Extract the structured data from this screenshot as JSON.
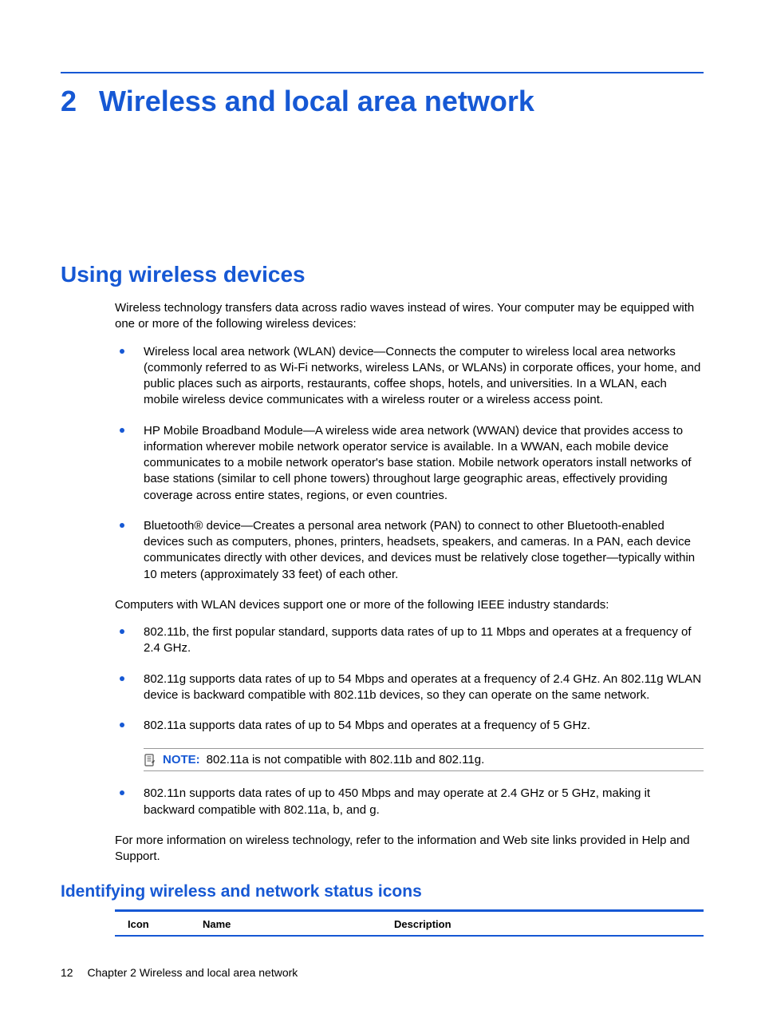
{
  "chapter": {
    "number": "2",
    "title": "Wireless and local area network"
  },
  "section": {
    "heading": "Using wireless devices",
    "intro": "Wireless technology transfers data across radio waves instead of wires. Your computer may be equipped with one or more of the following wireless devices:",
    "devices": [
      "Wireless local area network (WLAN) device—Connects the computer to wireless local area networks (commonly referred to as Wi-Fi networks, wireless LANs, or WLANs) in corporate offices, your home, and public places such as airports, restaurants, coffee shops, hotels, and universities. In a WLAN, each mobile wireless device communicates with a wireless router or a wireless access point.",
      "HP Mobile Broadband Module—A wireless wide area network (WWAN) device that provides access to information wherever mobile network operator service is available. In a WWAN, each mobile device communicates to a mobile network operator's base station. Mobile network operators install networks of base stations (similar to cell phone towers) throughout large geographic areas, effectively providing coverage across entire states, regions, or even countries.",
      "Bluetooth® device—Creates a personal area network (PAN) to connect to other Bluetooth-enabled devices such as computers, phones, printers, headsets, speakers, and cameras. In a PAN, each device communicates directly with other devices, and devices must be relatively close together—typically within 10 meters (approximately 33 feet) of each other."
    ],
    "standards_intro": "Computers with WLAN devices support one or more of the following IEEE industry standards:",
    "standards": [
      "802.11b, the first popular standard, supports data rates of up to 11 Mbps and operates at a frequency of 2.4 GHz.",
      "802.11g supports data rates of up to 54 Mbps and operates at a frequency of 2.4 GHz. An 802.11g WLAN device is backward compatible with 802.11b devices, so they can operate on the same network.",
      "802.11a supports data rates of up to 54 Mbps and operates at a frequency of 5 GHz."
    ],
    "note": {
      "label": "NOTE:",
      "text": "802.11a is not compatible with 802.11b and 802.11g."
    },
    "standards_after": [
      "802.11n supports data rates of up to 450 Mbps and may operate at 2.4 GHz or 5 GHz, making it backward compatible with 802.11a, b, and g."
    ],
    "more_info": "For more information on wireless technology, refer to the information and Web site links provided in Help and Support."
  },
  "subsection": {
    "heading": "Identifying wireless and network status icons",
    "table": {
      "col1": "Icon",
      "col2": "Name",
      "col3": "Description"
    }
  },
  "footer": {
    "page": "12",
    "chapter_label": "Chapter 2   Wireless and local area network"
  }
}
